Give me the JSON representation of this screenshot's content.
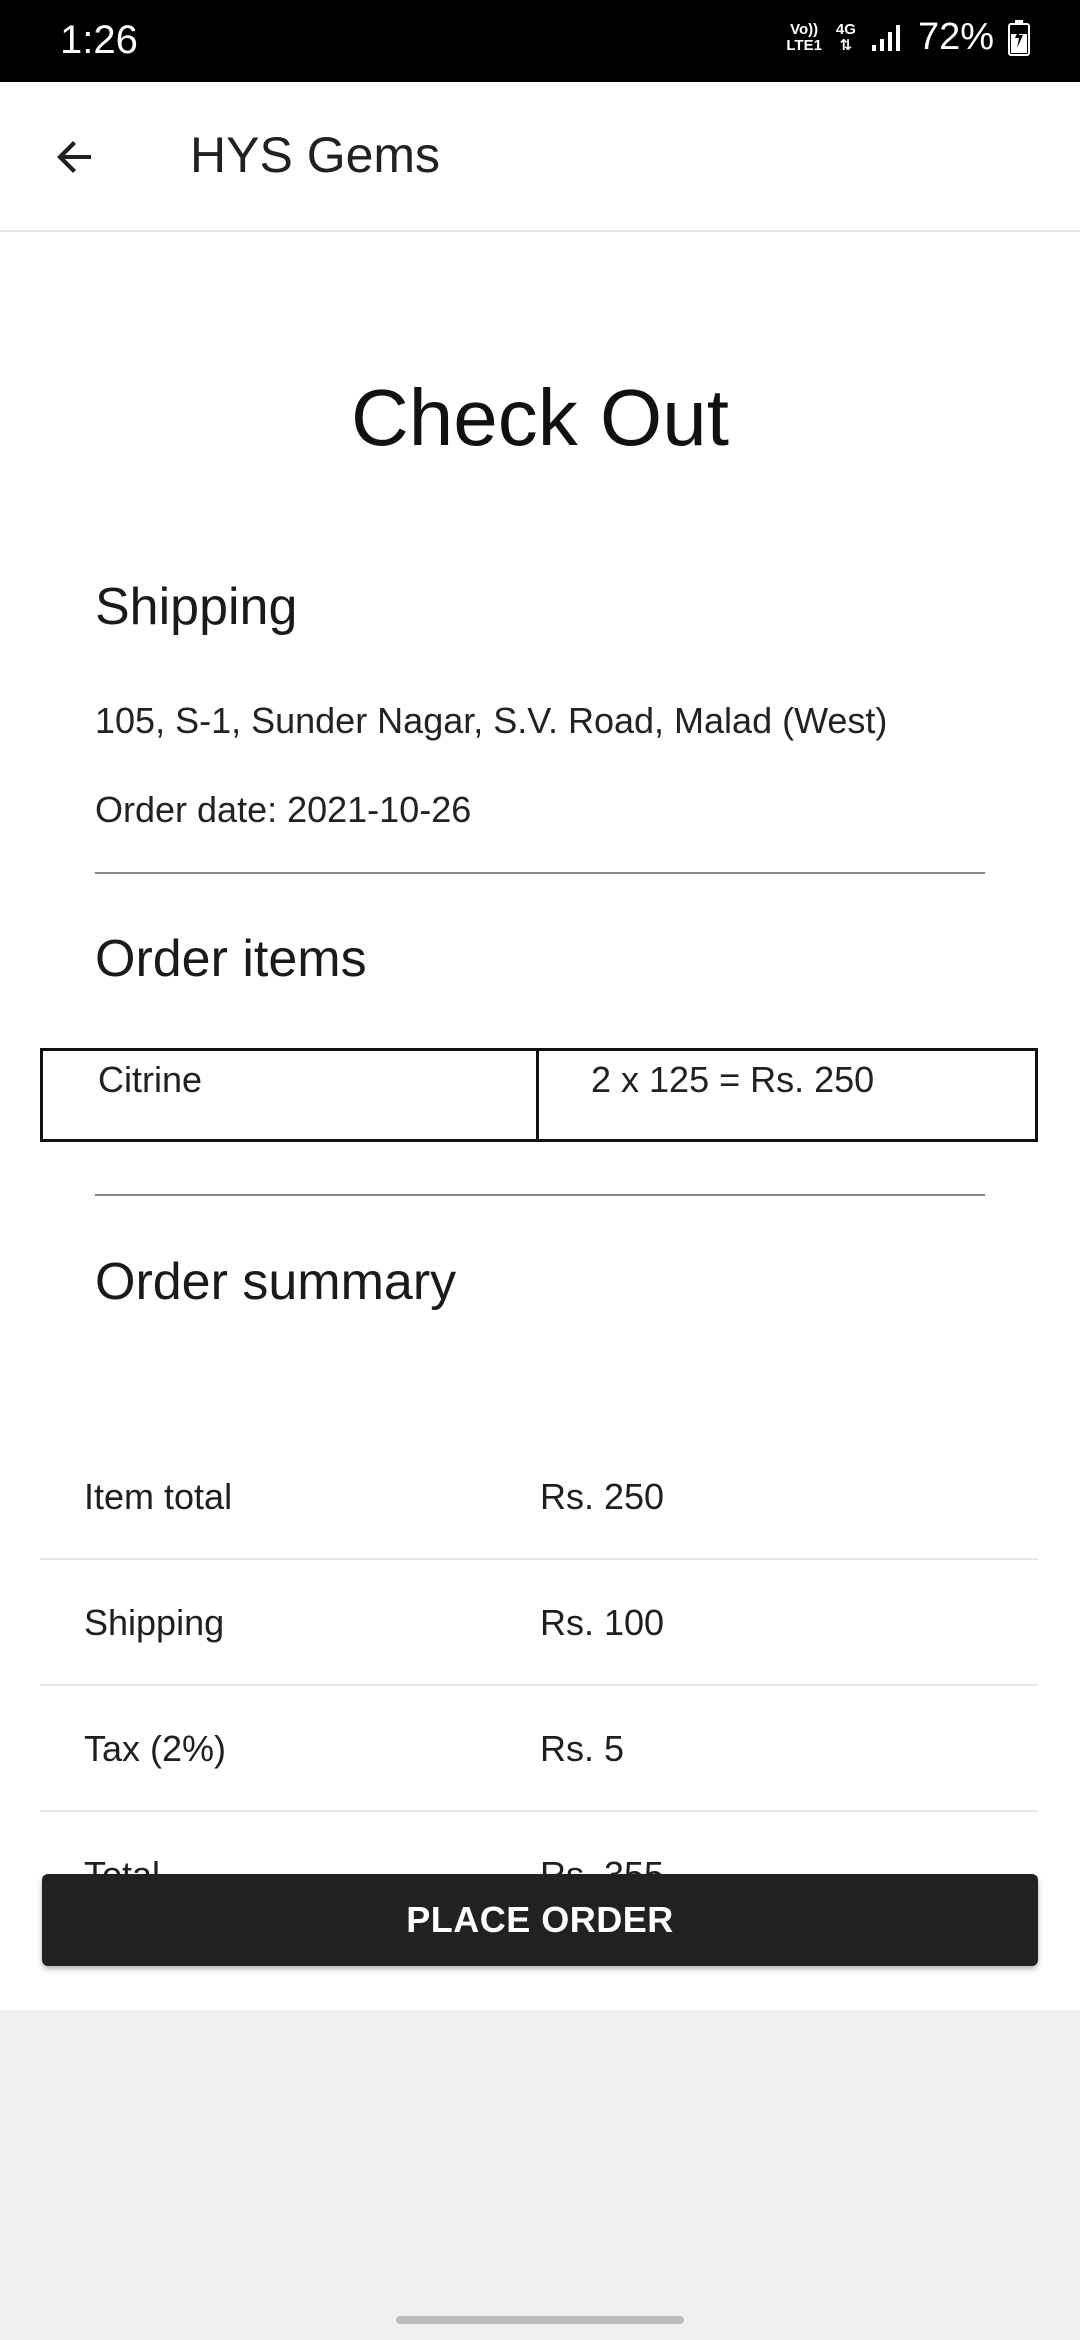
{
  "status_bar": {
    "time": "1:26",
    "network_top": "Vo))",
    "network_bottom": "LTE1",
    "data_type": "4G",
    "battery": "72%"
  },
  "app_bar": {
    "back_icon": "arrow-left-icon",
    "title": "HYS Gems"
  },
  "page": {
    "title": "Check Out",
    "shipping": {
      "heading": "Shipping",
      "address": "105, S-1, Sunder Nagar, S.V. Road, Malad (West)",
      "order_date": "Order date: 2021-10-26"
    },
    "order_items": {
      "heading": "Order items",
      "rows": [
        {
          "name": "Citrine",
          "calculation": "2 x 125 = Rs. 250"
        }
      ]
    },
    "order_summary": {
      "heading": "Order summary",
      "rows": [
        {
          "label": "Item total",
          "value": "Rs. 250"
        },
        {
          "label": "Shipping",
          "value": "Rs. 100"
        },
        {
          "label": "Tax (2%)",
          "value": "Rs. 5"
        },
        {
          "label": "Total",
          "value": "Rs. 355"
        }
      ]
    },
    "place_order_label": "PLACE ORDER"
  },
  "colors": {
    "status_bar": "#000000",
    "button": "#212121",
    "page_background": "#f0f0f0"
  }
}
